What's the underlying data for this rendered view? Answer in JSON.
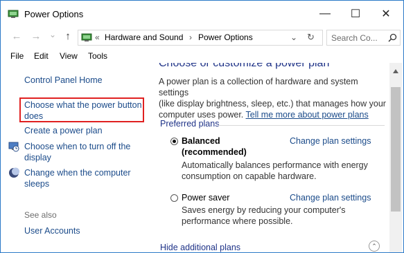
{
  "window": {
    "title": "Power Options",
    "minimize_glyph": "—",
    "maximize_glyph": "☐",
    "close_glyph": "✕"
  },
  "address": {
    "back_glyph": "←",
    "forward_glyph": "→",
    "dropdown_glyph": "⌄",
    "up_glyph": "↑",
    "overflow_glyph": "«",
    "crumbs": [
      "Hardware and Sound",
      "Power Options"
    ],
    "separator": "›",
    "refresh_glyph": "↻",
    "search_placeholder": "Search Co..."
  },
  "menu": [
    "File",
    "Edit",
    "View",
    "Tools"
  ],
  "sidebar": {
    "home": "Control Panel Home",
    "items": [
      {
        "line1": "Choose what the power button",
        "line2": "does"
      },
      {
        "line1": "Create a power plan",
        "line2": ""
      },
      {
        "line1": "Choose when to turn off the",
        "line2": "display"
      },
      {
        "line1": "Change when the computer",
        "line2": "sleeps"
      }
    ],
    "see_also": "See also",
    "user_accounts": "User Accounts"
  },
  "main": {
    "heading": "Choose or customize a power plan",
    "intro": [
      "A power plan is a collection of hardware and system settings",
      "(like display brightness, sleep, etc.) that manages how your",
      "computer uses power."
    ],
    "tell_me_more": "Tell me more about power plans",
    "preferred_label": "Preferred plans",
    "plans": [
      {
        "name_line1": "Balanced",
        "name_line2": "(recommended)",
        "selected": true,
        "change": "Change plan settings",
        "desc": [
          "Automatically balances performance with energy",
          "consumption on capable hardware."
        ]
      },
      {
        "name_line1": "Power saver",
        "name_line2": "",
        "selected": false,
        "change": "Change plan settings",
        "desc": [
          "Saves energy by reducing your computer's",
          "performance where possible."
        ]
      }
    ],
    "hide_additional": "Hide additional plans",
    "collapse_glyph": "⌃"
  },
  "colors": {
    "link": "#1b4b8a",
    "heading": "#1e3287",
    "highlight_box": "#e02020",
    "window_border": "#2b79c8"
  }
}
